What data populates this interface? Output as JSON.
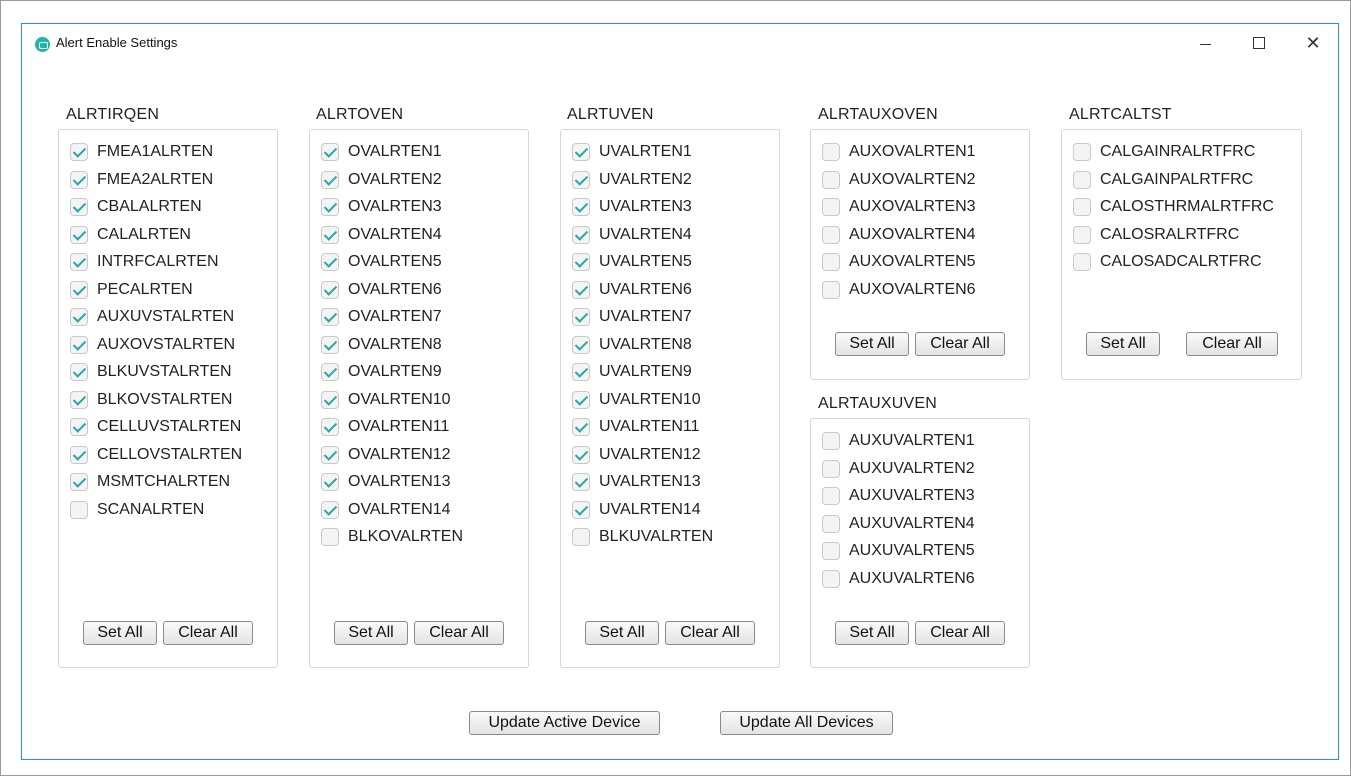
{
  "window": {
    "title": "Alert Enable Settings"
  },
  "groups": {
    "alrtirqen": {
      "title": "ALRTIRQEN",
      "items": [
        {
          "label": "FMEA1ALRTEN",
          "checked": true
        },
        {
          "label": "FMEA2ALRTEN",
          "checked": true
        },
        {
          "label": "CBALALRTEN",
          "checked": true
        },
        {
          "label": "CALALRTEN",
          "checked": true
        },
        {
          "label": "INTRFCALRTEN",
          "checked": true
        },
        {
          "label": "PECALRTEN",
          "checked": true
        },
        {
          "label": "AUXUVSTALRTEN",
          "checked": true
        },
        {
          "label": "AUXOVSTALRTEN",
          "checked": true
        },
        {
          "label": "BLKUVSTALRTEN",
          "checked": true
        },
        {
          "label": "BLKOVSTALRTEN",
          "checked": true
        },
        {
          "label": "CELLUVSTALRTEN",
          "checked": true
        },
        {
          "label": "CELLOVSTALRTEN",
          "checked": true
        },
        {
          "label": "MSMTCHALRTEN",
          "checked": true
        },
        {
          "label": "SCANALRTEN",
          "checked": false
        }
      ]
    },
    "alrtoven": {
      "title": "ALRTOVEN",
      "items": [
        {
          "label": "OVALRTEN1",
          "checked": true
        },
        {
          "label": "OVALRTEN2",
          "checked": true
        },
        {
          "label": "OVALRTEN3",
          "checked": true
        },
        {
          "label": "OVALRTEN4",
          "checked": true
        },
        {
          "label": "OVALRTEN5",
          "checked": true
        },
        {
          "label": "OVALRTEN6",
          "checked": true
        },
        {
          "label": "OVALRTEN7",
          "checked": true
        },
        {
          "label": "OVALRTEN8",
          "checked": true
        },
        {
          "label": "OVALRTEN9",
          "checked": true
        },
        {
          "label": "OVALRTEN10",
          "checked": true
        },
        {
          "label": "OVALRTEN11",
          "checked": true
        },
        {
          "label": "OVALRTEN12",
          "checked": true
        },
        {
          "label": "OVALRTEN13",
          "checked": true
        },
        {
          "label": "OVALRTEN14",
          "checked": true
        },
        {
          "label": "BLKOVALRTEN",
          "checked": false
        }
      ]
    },
    "alrtuven": {
      "title": "ALRTUVEN",
      "items": [
        {
          "label": "UVALRTEN1",
          "checked": true
        },
        {
          "label": "UVALRTEN2",
          "checked": true
        },
        {
          "label": "UVALRTEN3",
          "checked": true
        },
        {
          "label": "UVALRTEN4",
          "checked": true
        },
        {
          "label": "UVALRTEN5",
          "checked": true
        },
        {
          "label": "UVALRTEN6",
          "checked": true
        },
        {
          "label": "UVALRTEN7",
          "checked": true
        },
        {
          "label": "UVALRTEN8",
          "checked": true
        },
        {
          "label": "UVALRTEN9",
          "checked": true
        },
        {
          "label": "UVALRTEN10",
          "checked": true
        },
        {
          "label": "UVALRTEN11",
          "checked": true
        },
        {
          "label": "UVALRTEN12",
          "checked": true
        },
        {
          "label": "UVALRTEN13",
          "checked": true
        },
        {
          "label": "UVALRTEN14",
          "checked": true
        },
        {
          "label": "BLKUVALRTEN",
          "checked": false
        }
      ]
    },
    "alrtauxoven": {
      "title": "ALRTAUXOVEN",
      "items": [
        {
          "label": "AUXOVALRTEN1",
          "checked": false
        },
        {
          "label": "AUXOVALRTEN2",
          "checked": false
        },
        {
          "label": "AUXOVALRTEN3",
          "checked": false
        },
        {
          "label": "AUXOVALRTEN4",
          "checked": false
        },
        {
          "label": "AUXOVALRTEN5",
          "checked": false
        },
        {
          "label": "AUXOVALRTEN6",
          "checked": false
        }
      ]
    },
    "alrtauxuven": {
      "title": "ALRTAUXUVEN",
      "items": [
        {
          "label": "AUXUVALRTEN1",
          "checked": false
        },
        {
          "label": "AUXUVALRTEN2",
          "checked": false
        },
        {
          "label": "AUXUVALRTEN3",
          "checked": false
        },
        {
          "label": "AUXUVALRTEN4",
          "checked": false
        },
        {
          "label": "AUXUVALRTEN5",
          "checked": false
        },
        {
          "label": "AUXUVALRTEN6",
          "checked": false
        }
      ]
    },
    "alrtcaltst": {
      "title": "ALRTCALTST",
      "items": [
        {
          "label": "CALGAINRALRTFRC",
          "checked": false
        },
        {
          "label": "CALGAINPALRTFRC",
          "checked": false
        },
        {
          "label": "CALOSTHRMALRTFRC",
          "checked": false
        },
        {
          "label": "CALOSRALRTFRC",
          "checked": false
        },
        {
          "label": "CALOSADCALRTFRC",
          "checked": false
        }
      ]
    }
  },
  "buttons": {
    "set_all": "Set All",
    "clear_all": "Clear All",
    "update_active": "Update Active Device",
    "update_all": "Update All Devices"
  },
  "colors": {
    "accent_check": "#2aa6a6",
    "window_border": "#2b8fd6",
    "app_icon": "#1fb5a6"
  }
}
